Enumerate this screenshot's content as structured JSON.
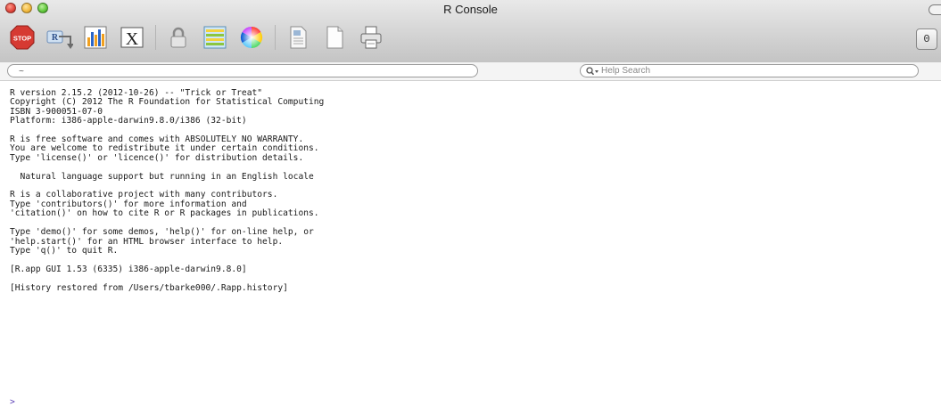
{
  "window": {
    "title": "R Console"
  },
  "toolbar": {
    "buttons": [
      {
        "id": "stop",
        "icon": "stop-icon",
        "label": "STOP"
      },
      {
        "id": "source",
        "icon": "source-script-icon"
      },
      {
        "id": "quartz",
        "icon": "new-quartz-window-icon"
      },
      {
        "id": "x11",
        "icon": "x11-window-icon",
        "label": "X"
      },
      {
        "id": "auth",
        "icon": "lock-icon"
      },
      {
        "id": "packages",
        "icon": "package-manager-icon"
      },
      {
        "id": "colors",
        "icon": "color-wheel-icon"
      },
      {
        "id": "open-doc",
        "icon": "open-document-icon"
      },
      {
        "id": "new-doc",
        "icon": "new-document-icon"
      },
      {
        "id": "print",
        "icon": "print-icon"
      }
    ],
    "side_button_label": "0"
  },
  "pathbar": {
    "working_dir": "~"
  },
  "search": {
    "placeholder": "Help Search"
  },
  "console": {
    "lines": [
      "R version 2.15.2 (2012-10-26) -- \"Trick or Treat\"",
      "Copyright (C) 2012 The R Foundation for Statistical Computing",
      "ISBN 3-900051-07-0",
      "Platform: i386-apple-darwin9.8.0/i386 (32-bit)",
      "",
      "R is free software and comes with ABSOLUTELY NO WARRANTY.",
      "You are welcome to redistribute it under certain conditions.",
      "Type 'license()' or 'licence()' for distribution details.",
      "",
      "  Natural language support but running in an English locale",
      "",
      "R is a collaborative project with many contributors.",
      "Type 'contributors()' for more information and",
      "'citation()' on how to cite R or R packages in publications.",
      "",
      "Type 'demo()' for some demos, 'help()' for on-line help, or",
      "'help.start()' for an HTML browser interface to help.",
      "Type 'q()' to quit R.",
      "",
      "[R.app GUI 1.53 (6335) i386-apple-darwin9.8.0]",
      "",
      "[History restored from /Users/tbarke000/.Rapp.history]"
    ],
    "prompt": ">"
  },
  "colors": {
    "prompt": "#5a3fb5",
    "stop_red": "#d63a32"
  }
}
